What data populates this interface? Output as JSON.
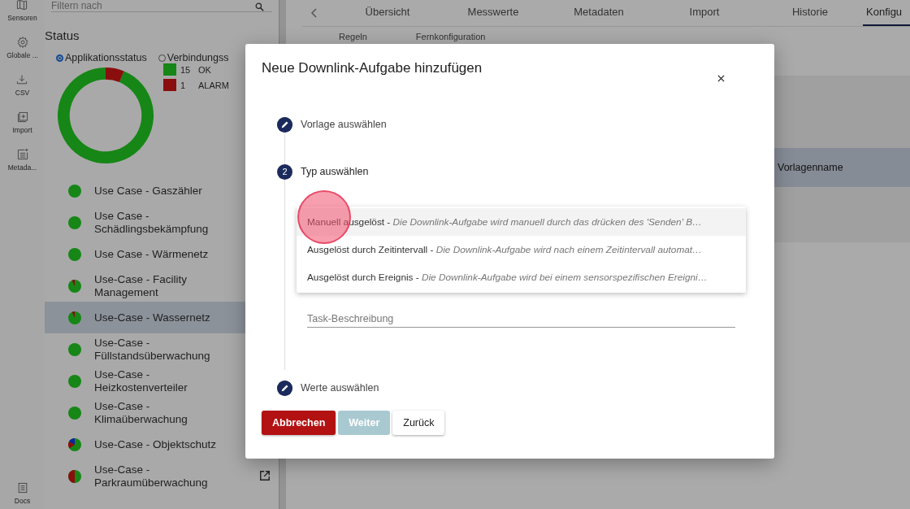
{
  "rail": {
    "items": [
      {
        "label": "Sensoren",
        "kind": "map"
      },
      {
        "label": "Globale ...",
        "kind": "gear"
      },
      {
        "label": "CSV",
        "kind": "download"
      },
      {
        "label": "Import",
        "kind": "add"
      },
      {
        "label": "Metada...",
        "kind": "list"
      }
    ],
    "bottom": {
      "label": "Docs",
      "kind": "doc"
    }
  },
  "panel": {
    "filter": {
      "placeholder": "Filtern nach"
    },
    "title": "Status",
    "radios": [
      {
        "label": "Applikationsstatus",
        "selected": true
      },
      {
        "label": "Verbindungss",
        "selected": false
      }
    ],
    "legend": [
      {
        "count": "15",
        "label": "OK",
        "color": "#168616"
      },
      {
        "count": "1",
        "label": "ALARM",
        "color": "#8a0e0e"
      }
    ],
    "items": [
      {
        "label": "Use Case - Gaszähler",
        "kind": "ok",
        "selected": false
      },
      {
        "label": "Use Case - Schädlingsbekämpfung",
        "kind": "ok",
        "selected": false
      },
      {
        "label": "Use Case - Wärmenetz",
        "kind": "ok",
        "selected": false
      },
      {
        "label": "Use-Case - Facility Management",
        "kind": "minor",
        "selected": false
      },
      {
        "label": "Use-Case - Wassernetz",
        "kind": "minor",
        "selected": true
      },
      {
        "label": "Use-Case - Füllstandsüberwachung",
        "kind": "ok",
        "selected": false
      },
      {
        "label": "Use-Case - Heizkostenverteiler",
        "kind": "ok",
        "selected": false
      },
      {
        "label": "Use-Case - Klimaüberwachung",
        "kind": "ok",
        "selected": false
      },
      {
        "label": "Use-Case - Objektschutz",
        "kind": "mixed",
        "selected": false
      },
      {
        "label": "Use-Case - Parkraumüberwachung",
        "kind": "half",
        "selected": false
      }
    ]
  },
  "tabs": [
    {
      "label": "Übersicht",
      "selected": false
    },
    {
      "label": "Messwerte",
      "selected": false
    },
    {
      "label": "Metadaten",
      "selected": false
    },
    {
      "label": "Import",
      "selected": false
    },
    {
      "label": "Historie",
      "selected": false
    },
    {
      "label": "Konfigu",
      "selected": true
    }
  ],
  "subtabs": [
    {
      "label": "Regeln"
    },
    {
      "label": "Fernkonfiguration"
    }
  ],
  "table": {
    "columns": [
      "Vorlagenname"
    ]
  },
  "dialog": {
    "title": "Neue Downlink-Aufgabe hinzufügen",
    "steps": [
      {
        "label": "Vorlage auswählen",
        "kind": "edit"
      },
      {
        "label": "Typ auswählen",
        "kind": "number",
        "number": "2"
      },
      {
        "label": "Werte auswählen",
        "kind": "edit"
      }
    ],
    "options": [
      {
        "label": "Manuell ausgelöst -",
        "description": "Die Downlink-Aufgabe wird manuell durch das drücken des 'Senden' B…",
        "selected": true
      },
      {
        "label": "Ausgelöst durch Zeitintervall -",
        "description": "Die Downlink-Aufgabe wird nach einem Zeitintervall automat…",
        "selected": false
      },
      {
        "label": "Ausgelöst durch Ereignis -",
        "description": "Die Downlink-Aufgabe wird bei einem sensorspezifischen Ereigni…",
        "selected": false
      }
    ],
    "description_field": {
      "placeholder": "Task-Beschreibung"
    },
    "buttons": [
      {
        "label": "Abbrechen",
        "kind": "primary",
        "disabled": false
      },
      {
        "label": "Weiter",
        "kind": "primary",
        "disabled": true
      },
      {
        "label": "Zurück",
        "kind": "secondary",
        "disabled": false
      }
    ]
  }
}
